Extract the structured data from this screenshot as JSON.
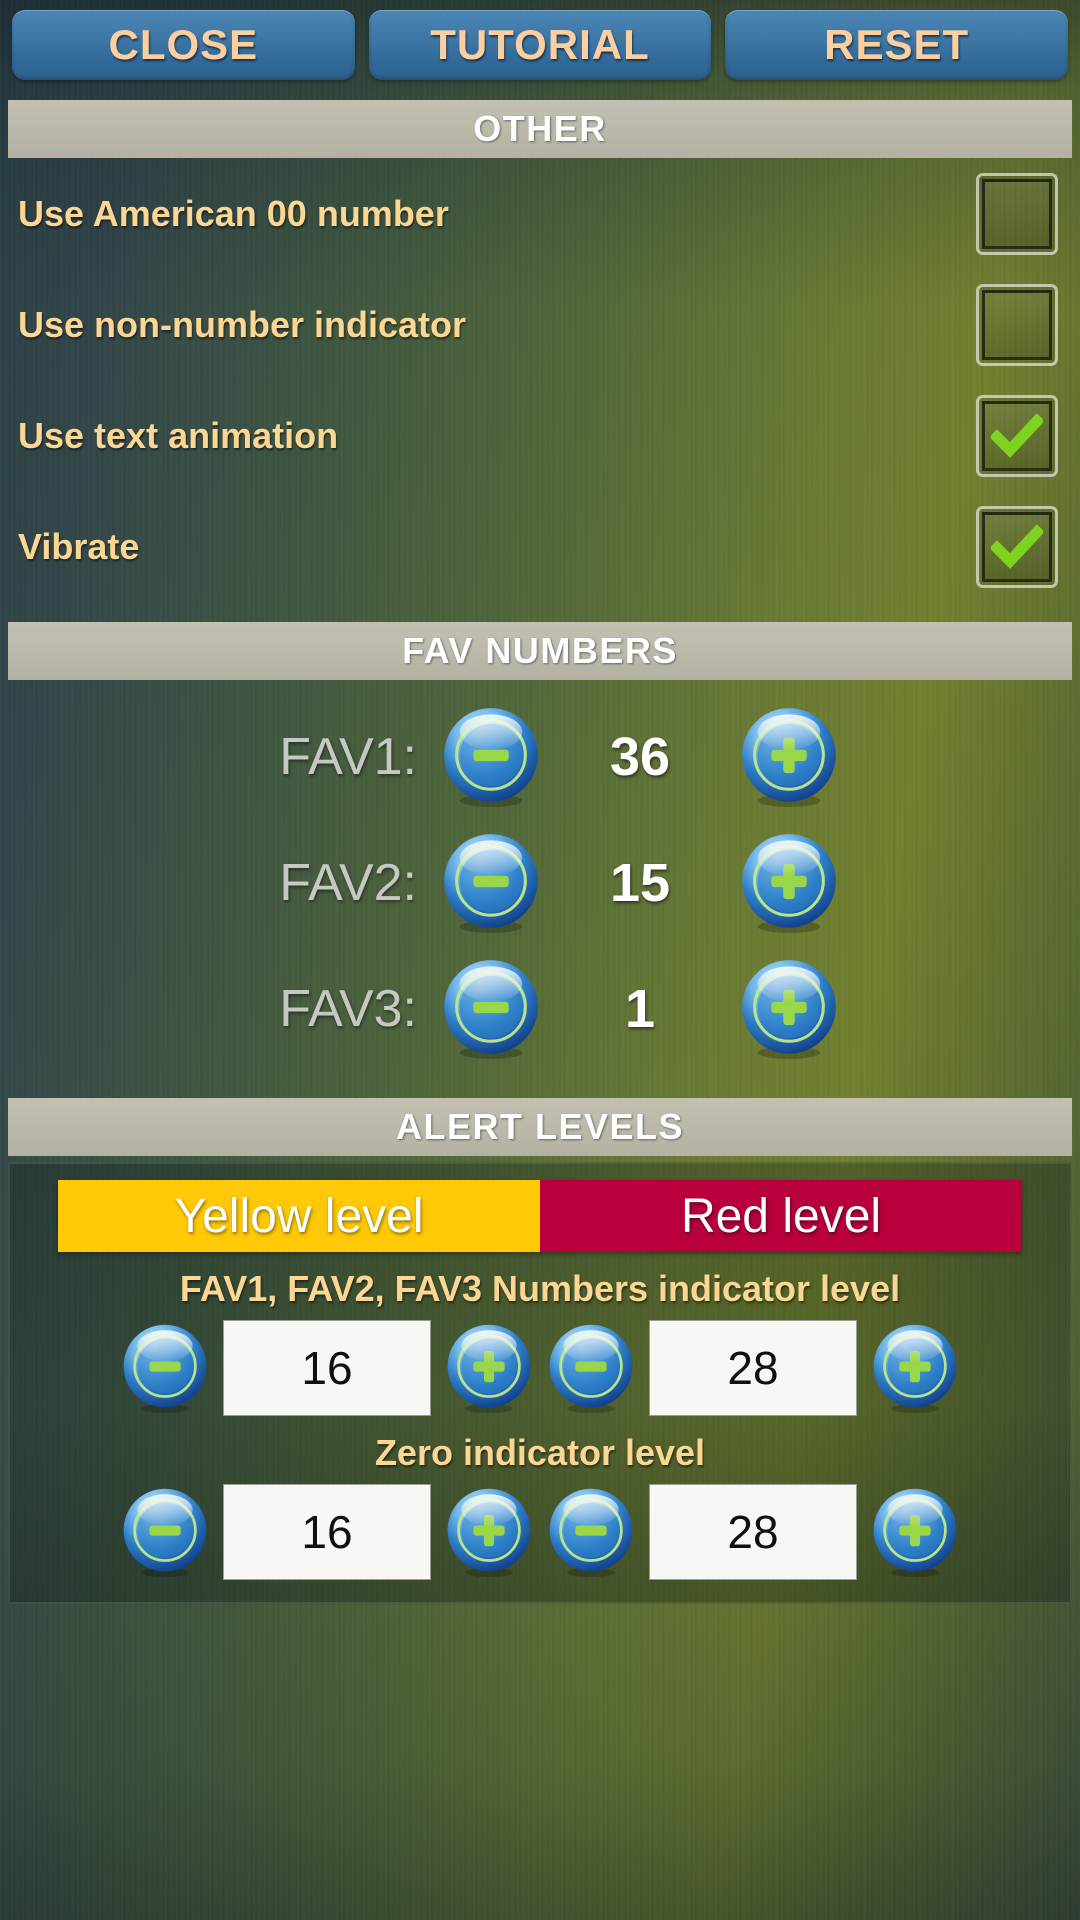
{
  "topbar": {
    "buttons": [
      {
        "label": "CLOSE",
        "name": "close-button"
      },
      {
        "label": "TUTORIAL",
        "name": "tutorial-button"
      },
      {
        "label": "RESET",
        "name": "reset-button"
      }
    ]
  },
  "sections": {
    "other": {
      "title": "OTHER"
    },
    "fav_numbers": {
      "title": "FAV NUMBERS"
    },
    "alert_levels": {
      "title": "ALERT LEVELS"
    }
  },
  "other_options": [
    {
      "label": "Use American 00 number",
      "checked": "false"
    },
    {
      "label": "Use non-number indicator",
      "checked": "false"
    },
    {
      "label": "Use text animation",
      "checked": "true"
    },
    {
      "label": "Vibrate",
      "checked": "true"
    }
  ],
  "fav_numbers": [
    {
      "label": "FAV1:",
      "value": "36"
    },
    {
      "label": "FAV2:",
      "value": "15"
    },
    {
      "label": "FAV3:",
      "value": "1"
    }
  ],
  "alert_levels": {
    "tabs": [
      {
        "label": "Yellow level",
        "color": "#FFC907",
        "text_color": "#ffffff"
      },
      {
        "label": "Red level",
        "color": "#B8003C",
        "text_color": "#ffffff"
      }
    ],
    "groups": [
      {
        "title": "FAV1, FAV2, FAV3 Numbers indicator level",
        "yellow_value": "16",
        "red_value": "28"
      },
      {
        "title": "Zero indicator level",
        "yellow_value": "16",
        "red_value": "28"
      }
    ]
  },
  "icons": {
    "minus": "minus-orb-icon",
    "plus": "plus-orb-icon",
    "check": "check-icon"
  },
  "colors": {
    "label_gold": "#FCD794",
    "button_blue": "#3D77A6",
    "button_text": "#FBCFA0",
    "header_bar": "#BCB9AB",
    "check_green": "#7ED321",
    "yellow_level": "#FFC907",
    "red_level": "#B8003C"
  }
}
